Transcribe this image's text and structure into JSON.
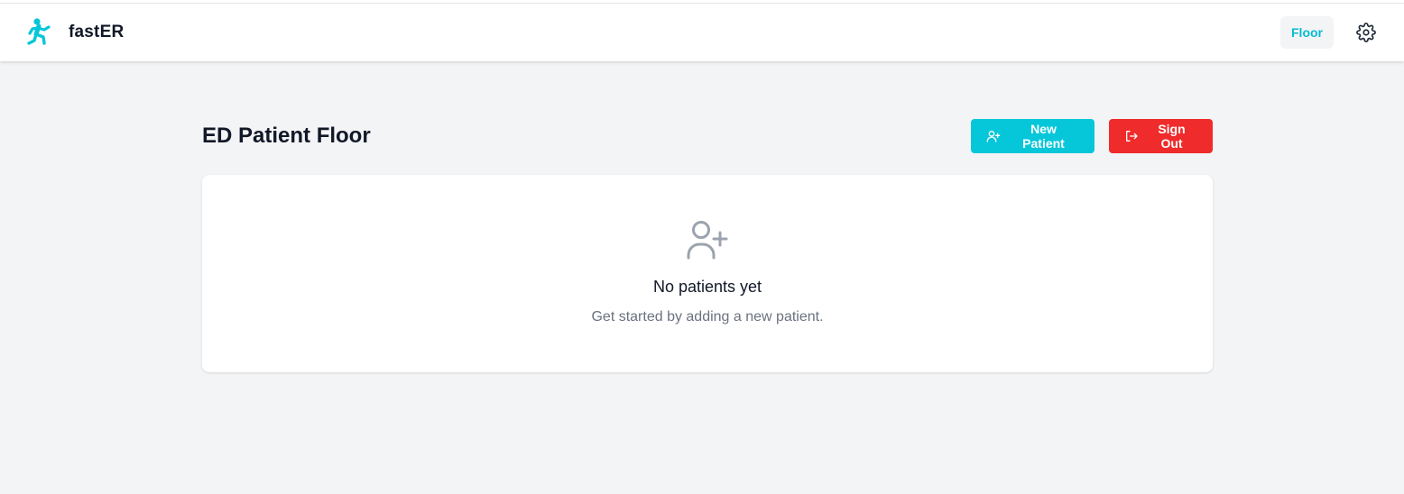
{
  "app": {
    "name": "fastER",
    "accent_color": "#06c7d9",
    "danger_color": "#ef2b2b",
    "logo_icon": "running-person-icon"
  },
  "nav": {
    "links": [
      {
        "label": "Floor",
        "active": true
      }
    ],
    "settings_icon": "gear-icon"
  },
  "page": {
    "title": "ED Patient Floor",
    "actions": {
      "new_patient": {
        "label": "New Patient",
        "icon": "user-plus-icon"
      },
      "sign_out": {
        "label": "Sign Out",
        "icon": "sign-out-icon"
      }
    }
  },
  "empty_state": {
    "icon": "user-plus-icon",
    "title": "No patients yet",
    "subtitle": "Get started by adding a new patient."
  }
}
